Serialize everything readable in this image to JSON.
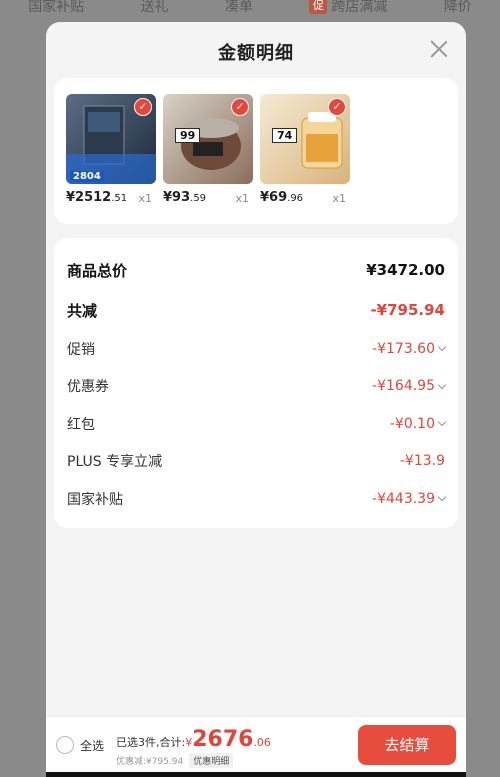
{
  "backdrop": {
    "tabs": [
      "国家补贴",
      "送礼",
      "凑单",
      "跨店满减",
      "降价"
    ],
    "promo_badge": "促"
  },
  "sheet": {
    "title": "金额明细"
  },
  "products": [
    {
      "price_int": "¥2512",
      "price_dec": ".51",
      "qty": "x1",
      "thumb_tag": "2804",
      "thumb_price": "",
      "colors": [
        "#4e5d70",
        "#2b3646"
      ]
    },
    {
      "price_int": "¥93",
      "price_dec": ".59",
      "qty": "x1",
      "thumb_tag": "",
      "thumb_price": "99",
      "colors": [
        "#c9c2b8",
        "#6b4b3c"
      ]
    },
    {
      "price_int": "¥69",
      "price_dec": ".96",
      "qty": "x1",
      "thumb_tag": "",
      "thumb_price": "74",
      "colors": [
        "#f2e3c9",
        "#d39c4c"
      ]
    }
  ],
  "details": {
    "total_label": "商品总价",
    "total_value": "¥3472.00",
    "reduce_label": "共减",
    "reduce_value": "-¥795.94",
    "rows": [
      {
        "label": "促销",
        "value": "-¥173.60"
      },
      {
        "label": "优惠券",
        "value": "-¥164.95"
      },
      {
        "label": "红包",
        "value": "-¥0.10"
      },
      {
        "label": "PLUS 专享立减",
        "value": "-¥13.9"
      },
      {
        "label": "国家补贴",
        "value": "-¥443.39"
      }
    ]
  },
  "footer": {
    "select_all": "全选",
    "summary_prefix": "已选3件,合计:",
    "currency": "¥",
    "total_int": "2676",
    "total_dec": ".06",
    "discount_text": "优惠减:¥795.94",
    "detail_pill": "优惠明细",
    "checkout": "去结算"
  },
  "colors": {
    "accent_red": "#e74c3c",
    "text_red": "#e0453a"
  }
}
